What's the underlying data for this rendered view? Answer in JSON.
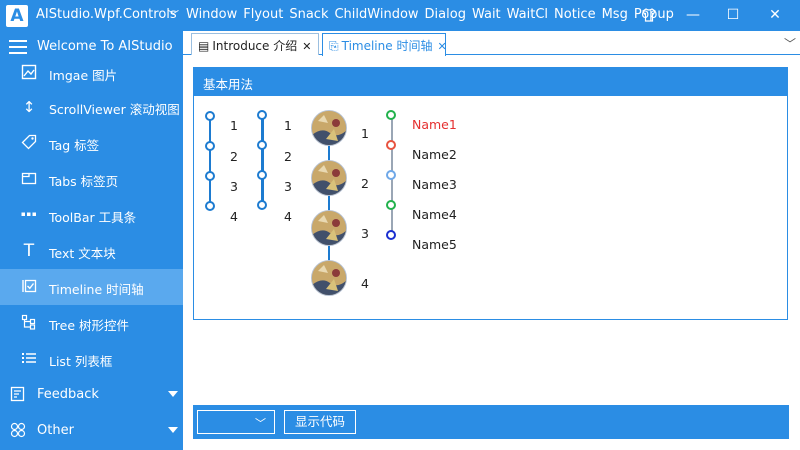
{
  "window": {
    "title": "AIStudio.Wpf.Controls",
    "menu": [
      "Window",
      "Flyout",
      "Snack",
      "ChildWindow",
      "Dialog",
      "Wait",
      "WaitCl",
      "Notice",
      "Msg",
      "Popup"
    ]
  },
  "sidebar": {
    "header": "Welcome To AIStudio",
    "items": [
      {
        "label": "Imgae 图片",
        "icon": "image-icon"
      },
      {
        "label": "ScrollViewer 滚动视图",
        "icon": "scroll-arrow-icon"
      },
      {
        "label": "Tag 标签",
        "icon": "tag-icon"
      },
      {
        "label": "Tabs 标签页",
        "icon": "tabs-icon"
      },
      {
        "label": "ToolBar 工具条",
        "icon": "toolbar-dots-icon"
      },
      {
        "label": "Text 文本块",
        "icon": "text-icon"
      },
      {
        "label": "Timeline 时间轴",
        "icon": "timeline-check-icon",
        "active": true
      },
      {
        "label": "Tree 树形控件",
        "icon": "tree-icon"
      },
      {
        "label": "List 列表框",
        "icon": "list-icon"
      }
    ],
    "groups": [
      {
        "label": "Feedback",
        "icon": "feedback-icon"
      },
      {
        "label": "Other",
        "icon": "other-icon"
      }
    ]
  },
  "tabs": [
    {
      "label": "Introduce 介绍",
      "icon": "document-icon"
    },
    {
      "label": "Timeline 时间轴",
      "icon": "timeline-tab-icon",
      "active": true
    }
  ],
  "panel": {
    "header": "基本用法",
    "timeline1": [
      "1",
      "2",
      "3",
      "4"
    ],
    "timeline2": [
      "1",
      "2",
      "3",
      "4"
    ],
    "timeline3": [
      "1",
      "2",
      "3",
      "4"
    ],
    "timeline4": [
      {
        "label": "Name1",
        "color": "#22b24c",
        "text_color": "#e53030"
      },
      {
        "label": "Name2",
        "color": "#e8533f"
      },
      {
        "label": "Name3",
        "color": "#6fa8e8"
      },
      {
        "label": "Name4",
        "color": "#22b24c"
      },
      {
        "label": "Name5",
        "color": "#1a2fd0"
      }
    ]
  },
  "bottom": {
    "combo_value": "",
    "show_code": "显示代码"
  },
  "colors": {
    "accent": "#2b8de4",
    "sidebar_active": "#5aa9ee",
    "timeline": "#1d7bd0"
  }
}
